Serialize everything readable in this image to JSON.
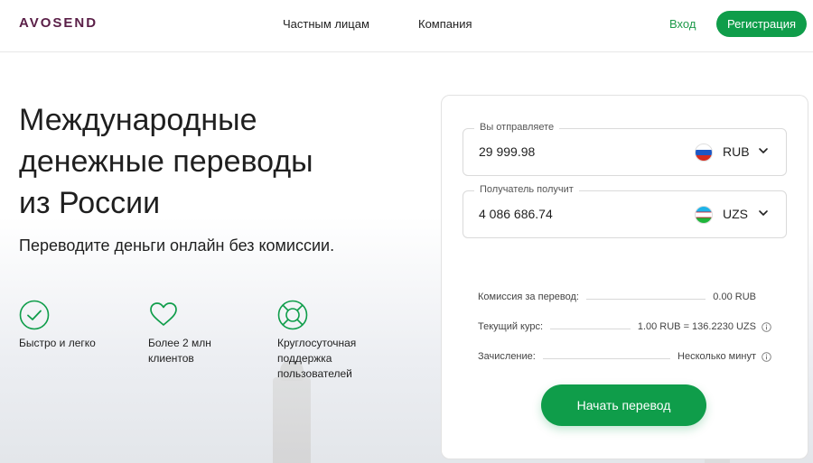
{
  "header": {
    "logo": "AVOSEND",
    "nav": [
      "Частным лицам",
      "Компания"
    ],
    "login": "Вход",
    "register": "Регистрация"
  },
  "hero": {
    "title_lines": [
      "Международные",
      "денежные переводы",
      "из России"
    ],
    "subtitle": "Переводите деньги онлайн без комиссии.",
    "features": [
      {
        "icon": "check-circle-icon",
        "text": "Быстро и легко"
      },
      {
        "icon": "heart-icon",
        "text": "Более 2 млн\nклиентов"
      },
      {
        "icon": "lifebuoy-icon",
        "text": "Круглосуточная\nподдержка\nпользователей"
      }
    ]
  },
  "transfer": {
    "send": {
      "label": "Вы отправляете",
      "value": "29 999.98",
      "currency": "RUB",
      "flag": "russia-flag-icon"
    },
    "receive": {
      "label": "Получатель получит",
      "value": "4 086 686.74",
      "currency": "UZS",
      "flag": "uzbekistan-flag-icon"
    },
    "fee": {
      "label": "Комиссия за перевод:",
      "value": "0.00 RUB"
    },
    "rate": {
      "label": "Текущий курс:",
      "value": "1.00 RUB = 136.2230 UZS"
    },
    "delivery": {
      "label": "Зачисление:",
      "value": "Несколько минут"
    },
    "button": "Начать перевод"
  },
  "colors": {
    "accent": "#0f9d4a",
    "logo": "#5a1f47",
    "login": "#1e9a4a"
  }
}
